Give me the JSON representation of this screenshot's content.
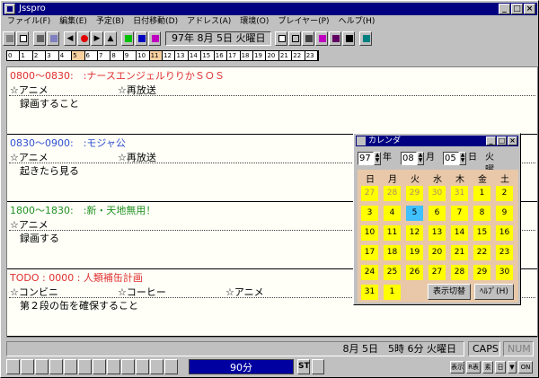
{
  "window": {
    "title": "Jsspro"
  },
  "menu": [
    "ファイル(F)",
    "編集(E)",
    "予定(B)",
    "日付移動(D)",
    "アドレス(A)",
    "環境(O)",
    "プレイヤー(P)",
    "ヘルプ(H)"
  ],
  "toolbar": {
    "date": "97年 8月 5日 火曜日"
  },
  "ruler": {
    "hours": [
      "0",
      "1",
      "2",
      "3",
      "4",
      "5",
      "6",
      "7",
      "8",
      "9",
      "10",
      "11",
      "12",
      "13",
      "14",
      "15",
      "16",
      "17",
      "18",
      "19",
      "20",
      "21",
      "22",
      "23"
    ]
  },
  "entries": [
    {
      "time": "0800～0830:　:ナースエンジェルりりかＳＯＳ",
      "color": "#e03030",
      "tags": [
        "☆アニメ",
        "☆再放送"
      ],
      "note": "録画すること"
    },
    {
      "time": "0830～0900:　:モジャ公",
      "color": "#3050d0",
      "tags": [
        "☆アニメ",
        "☆再放送"
      ],
      "note": "起きたら見る"
    },
    {
      "time": "1800～1830:　:新・天地無用！",
      "color": "#209020",
      "tags": [
        "☆アニメ"
      ],
      "note": "録画する"
    },
    {
      "time": "TODO : 0000 : 人類補缶計画",
      "color": "#e03030",
      "tags": [
        "☆コンビニ",
        "☆コーヒー",
        "☆アニメ"
      ],
      "note": "第２段の缶を確保すること"
    }
  ],
  "calendar": {
    "title": "カレンダ",
    "year": "97",
    "year_label": "年",
    "month": "08",
    "month_label": "月",
    "day": "05",
    "day_label": "日",
    "weekday": "火曜日",
    "dow": [
      "日",
      "月",
      "火",
      "水",
      "木",
      "金",
      "土"
    ],
    "weeks": [
      [
        "27",
        "28",
        "29",
        "30",
        "31",
        "1",
        "2"
      ],
      [
        "3",
        "4",
        "5",
        "6",
        "7",
        "8",
        "9"
      ],
      [
        "10",
        "11",
        "12",
        "13",
        "14",
        "15",
        "16"
      ],
      [
        "17",
        "18",
        "19",
        "20",
        "21",
        "22",
        "23"
      ],
      [
        "24",
        "25",
        "26",
        "27",
        "28",
        "29",
        "30"
      ],
      [
        "31",
        "1"
      ]
    ],
    "toggle_label": "表示切替",
    "help_label": "ﾍﾙﾌﾟ(H)"
  },
  "status": {
    "datetime": "8月 5日　5時 6分 火曜日",
    "caps": "CAPS",
    "num": "NUM"
  },
  "bottom": {
    "progress": "90分",
    "st": "ST",
    "small": [
      "表示",
      "R表",
      "素",
      "日",
      "ON"
    ]
  }
}
